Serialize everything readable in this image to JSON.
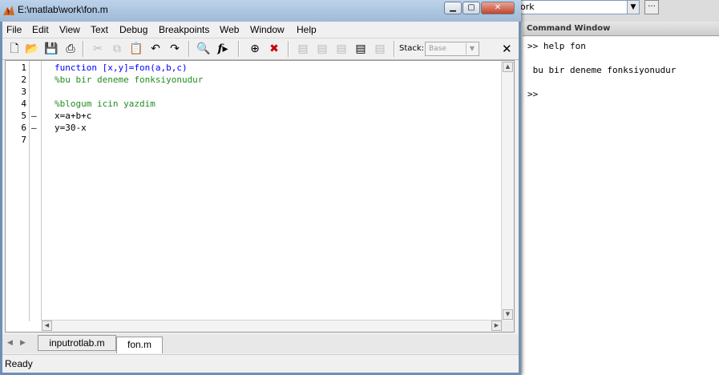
{
  "main_window": {
    "current_dir_fragment": "ork",
    "dir_browse_label": "...",
    "command_window": {
      "title": "Command Window",
      "lines": [
        ">> help fon",
        " bu bir deneme fonksiyonudur",
        ">>"
      ]
    }
  },
  "editor": {
    "title": "E:\\matlab\\work\\fon.m",
    "menu": [
      "File",
      "Edit",
      "View",
      "Text",
      "Debug",
      "Breakpoints",
      "Web",
      "Window",
      "Help"
    ],
    "stack": {
      "label": "Stack:",
      "value": "Base"
    },
    "line_numbers": [
      "1",
      "2",
      "3",
      "4",
      "5",
      "6",
      "7"
    ],
    "breakpoint_marks": [
      "",
      "",
      "",
      "",
      "–",
      "–",
      ""
    ],
    "code_lines": [
      {
        "text": "function [x,y]=fon(a,b,c)",
        "kind": "keyword"
      },
      {
        "text": "%bu bir deneme fonksiyonudur",
        "kind": "comment"
      },
      {
        "text": "",
        "kind": "plain"
      },
      {
        "text": "%blogum icin yazdim",
        "kind": "comment"
      },
      {
        "text": "x=a+b+c",
        "kind": "plain"
      },
      {
        "text": "y=30-x",
        "kind": "plain"
      },
      {
        "text": "",
        "kind": "plain"
      }
    ],
    "tabs": [
      {
        "label": "inputrotlab.m",
        "active": false
      },
      {
        "label": "fon.m",
        "active": true
      }
    ],
    "status": "Ready"
  },
  "colors": {
    "keyword": "#0000ff",
    "comment": "#228b22",
    "titlebar": "#9fb9d6"
  }
}
